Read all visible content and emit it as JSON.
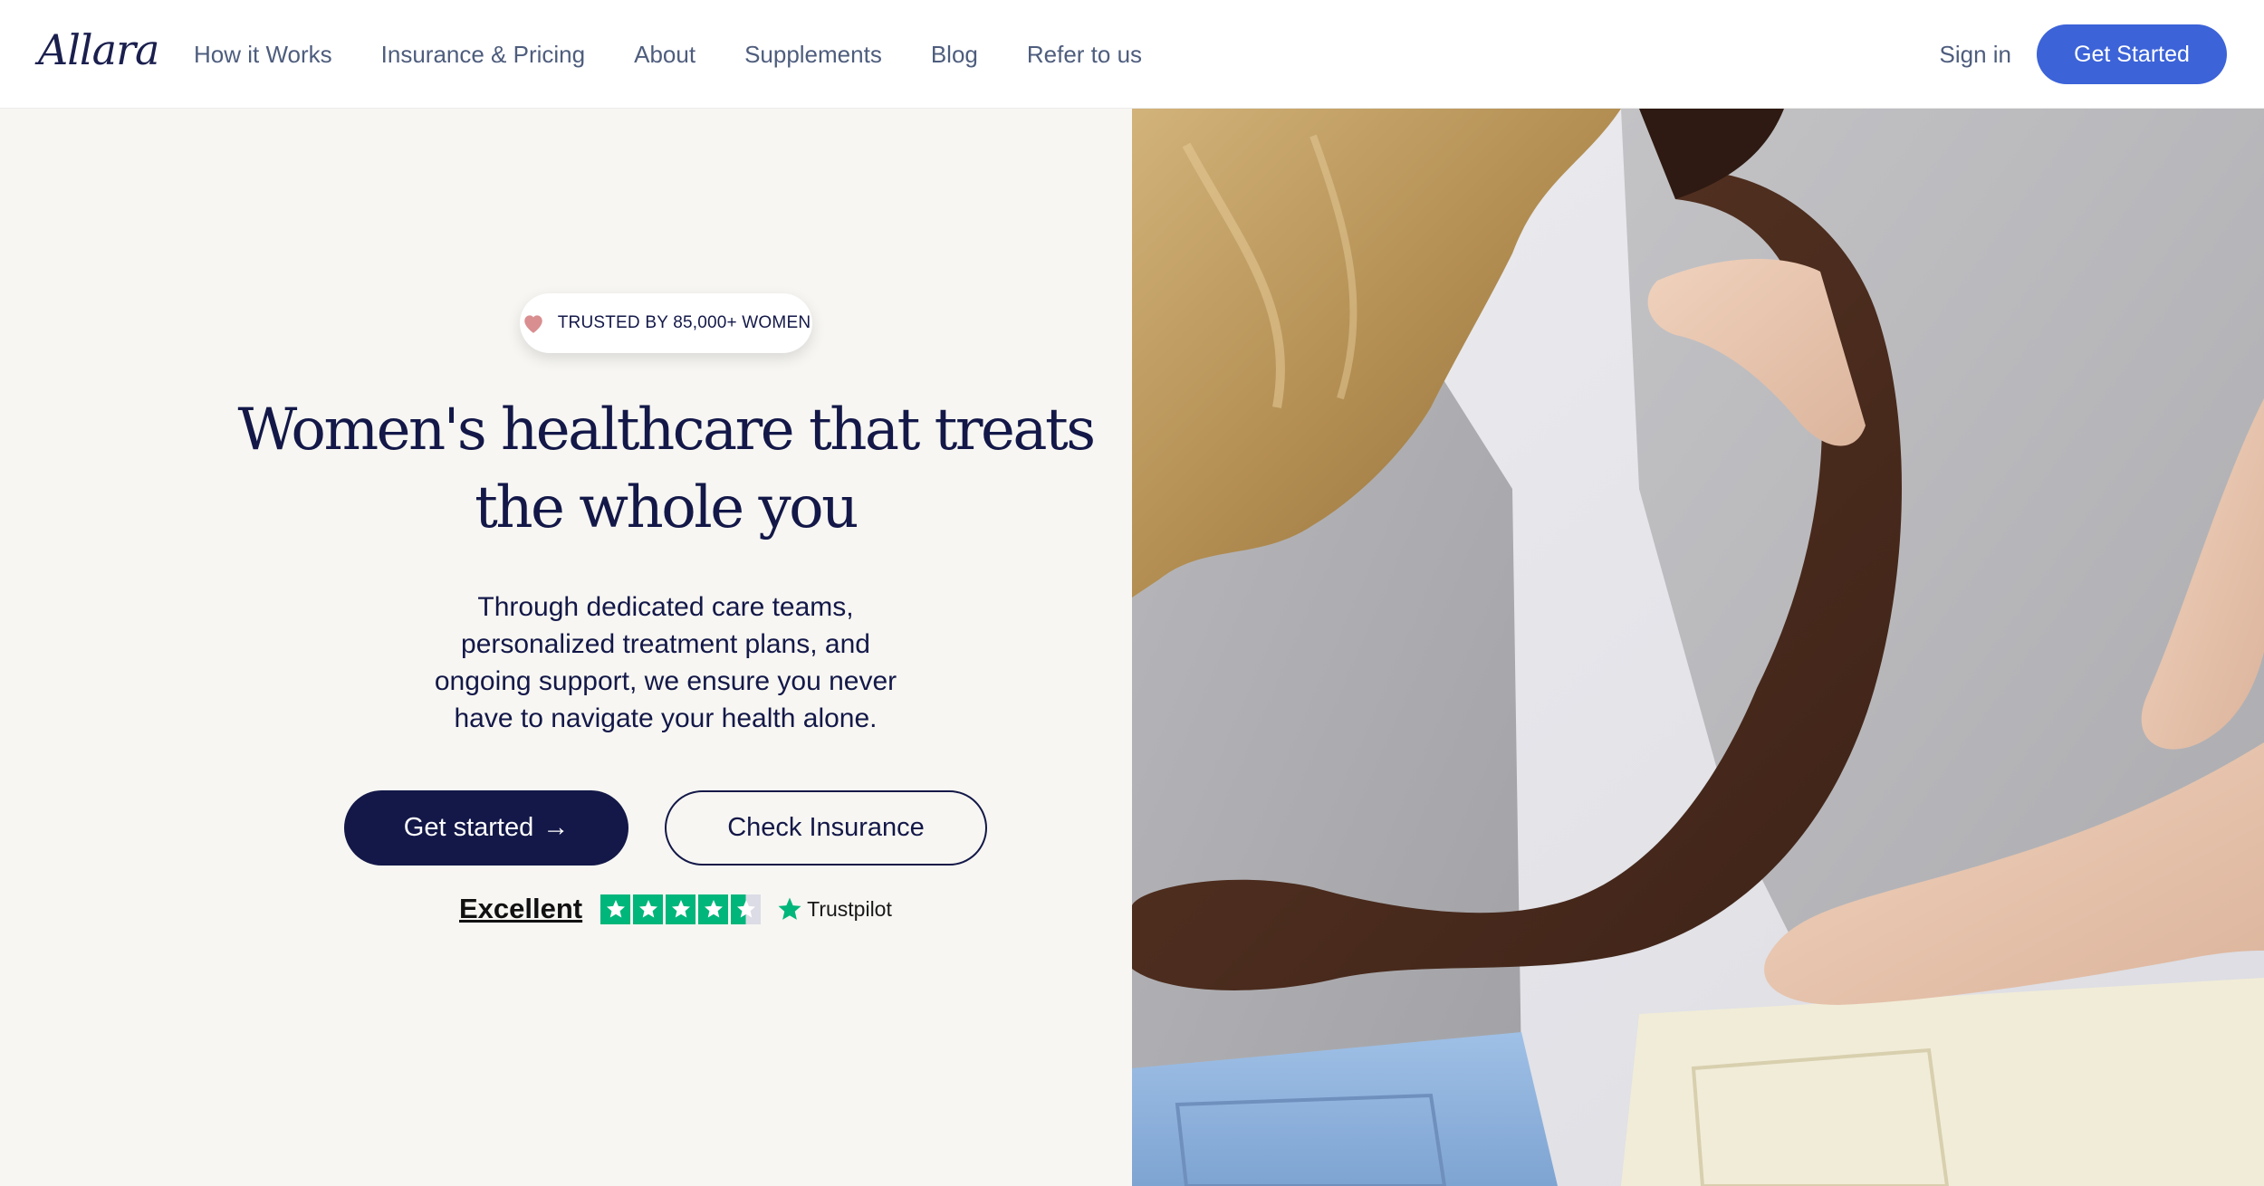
{
  "nav": {
    "logo": "Allara",
    "links": [
      "How it Works",
      "Insurance & Pricing",
      "About",
      "Supplements",
      "Blog",
      "Refer to us"
    ],
    "sign_in": "Sign in",
    "cta": "Get Started"
  },
  "hero": {
    "badge": "TRUSTED BY 85,000+ WOMEN",
    "badge_icon": "heart-icon",
    "headline": "Women's healthcare that treats the whole you",
    "subtext": "Through dedicated care teams, personalized treatment plans, and ongoing support, we ensure you never have to navigate your health alone.",
    "primary_cta": "Get started",
    "primary_cta_arrow": "→",
    "secondary_cta": "Check Insurance"
  },
  "trustpilot": {
    "rating_text": "Excellent",
    "stars": 4.5,
    "brand": "Trustpilot"
  },
  "colors": {
    "navy": "#131848",
    "accent_blue": "#3c63d8",
    "hero_bg": "#f7f6f2",
    "nav_text": "#4e5d7d",
    "trustpilot_green": "#00b67a",
    "heart": "#d98e90"
  },
  "image": {
    "description_icon": "photo-two-women-embracing"
  }
}
